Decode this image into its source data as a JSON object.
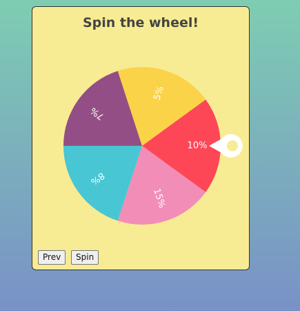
{
  "title": "Spin the wheel!",
  "buttons": {
    "prev": "Prev",
    "spin": "Spin"
  },
  "wheel": {
    "segments": [
      {
        "label": "10%",
        "color": "#fd4757"
      },
      {
        "label": "15%",
        "color": "#f28db8"
      },
      {
        "label": "8%",
        "color": "#48c6d3"
      },
      {
        "label": "7%",
        "color": "#934f85"
      },
      {
        "label": "5%",
        "color": "#fad348"
      }
    ],
    "pointer_color": "#ffffff",
    "pointer_center_color": "#f7ec93"
  }
}
